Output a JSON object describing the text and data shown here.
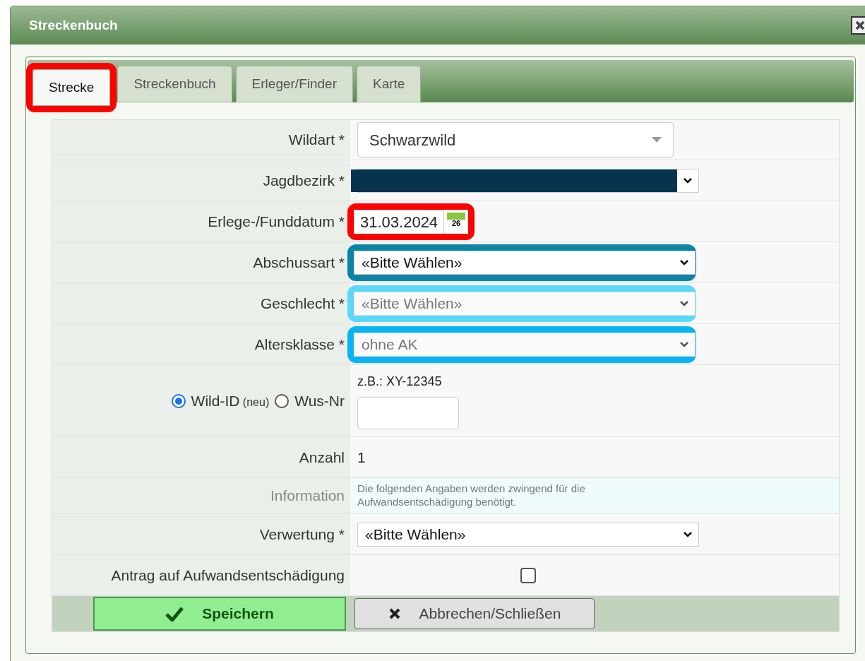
{
  "window": {
    "title": "Streckenbuch"
  },
  "tabs": [
    {
      "label": "Strecke",
      "selected": true,
      "color": "#ff0000"
    },
    {
      "label": "Streckenbuch",
      "selected": false
    },
    {
      "label": "Erleger/Finder",
      "selected": false
    },
    {
      "label": "Karte",
      "selected": false
    }
  ],
  "fields": [
    {
      "kind": "combo",
      "label": "Wildart *",
      "value": "Schwarzwild"
    },
    {
      "kind": "select",
      "label": "Jagdbezirk *",
      "redacted": true
    },
    {
      "kind": "date",
      "label": "Erlege-/Funddatum *",
      "value": "31.03.2024",
      "calendar_day": "26",
      "color": "#ff0000"
    },
    {
      "kind": "select",
      "label": "Abschussart *",
      "value": "«Bitte Wählen»",
      "disabled": false,
      "color": "#0b85a5"
    },
    {
      "kind": "select",
      "label": "Geschlecht *",
      "value": "«Bitte Wählen»",
      "disabled": true,
      "color": "#5ad8f8"
    },
    {
      "kind": "select",
      "label": "Altersklasse *",
      "value": "ohne AK",
      "disabled": true,
      "color": "#07b5f7"
    },
    {
      "kind": "id",
      "options": [
        {
          "label": "Wild-ID",
          "note": "(neu)",
          "selected": true
        },
        {
          "label": "Wus-Nr",
          "selected": false
        }
      ],
      "hint": "z.B.: XY-12345"
    },
    {
      "kind": "text",
      "label": "Anzahl",
      "value": "1"
    },
    {
      "kind": "info",
      "label": "Information",
      "value": "Die folgenden Angaben werden zwingend für die Aufwandsentschädigung benötigt."
    },
    {
      "kind": "select",
      "label": "Verwertung *",
      "value": "«Bitte Wählen»",
      "disabled": false
    },
    {
      "kind": "checkbox",
      "label": "Antrag auf Aufwandsentschädigung",
      "checked": false
    }
  ],
  "buttons": [
    {
      "kind": "save",
      "label": "Speichern"
    },
    {
      "kind": "cancel",
      "label": "Abbrechen/Schließen"
    }
  ]
}
